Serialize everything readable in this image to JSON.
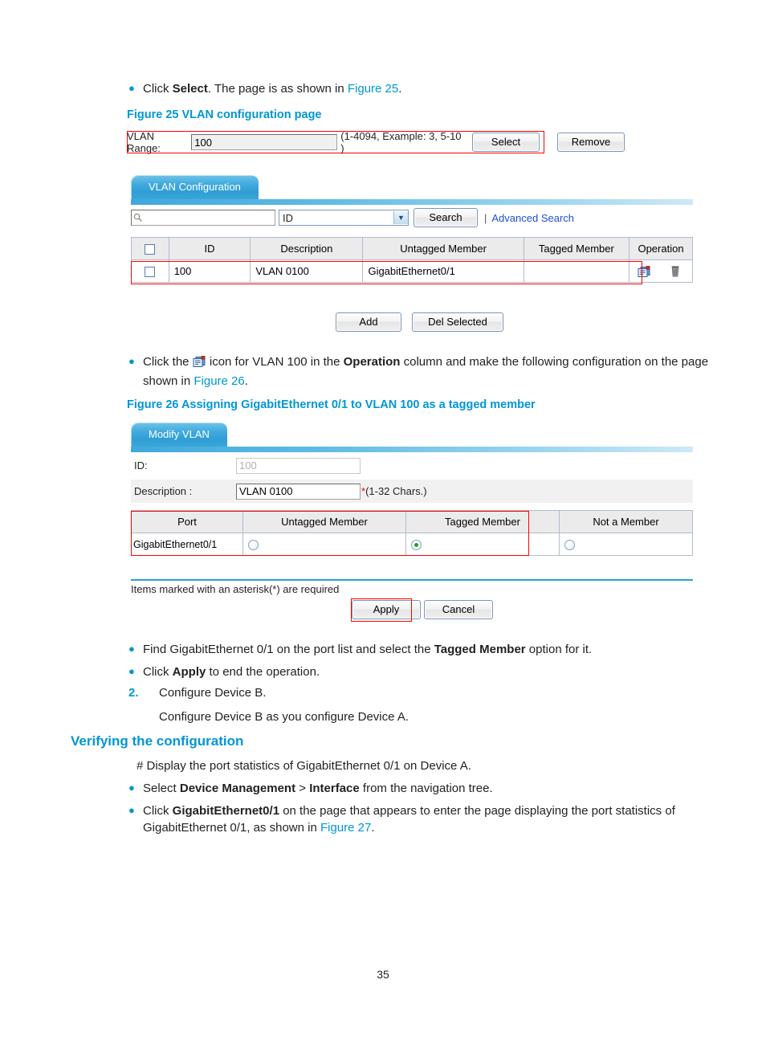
{
  "page_number": "35",
  "intro_bullet": {
    "text_before": "Click ",
    "bold": "Select",
    "text_mid": ". The page is as shown in ",
    "link": "Figure 25",
    "text_after": "."
  },
  "figure25": {
    "caption": "Figure 25 VLAN configuration page",
    "vlan_range": {
      "label": "VLAN Range:",
      "value": "100",
      "hint": "(1-4094, Example: 3, 5-10 )",
      "select_button": "Select",
      "remove_button": "Remove"
    },
    "tab_label": "VLAN Configuration",
    "search": {
      "input_value": "",
      "search_icon": "search-icon",
      "field_selector_value": "ID",
      "search_button": "Search",
      "separator": "|",
      "advanced_link": "Advanced Search"
    },
    "table": {
      "headers": [
        "",
        "ID",
        "Description",
        "Untagged Member",
        "Tagged Member",
        "Operation"
      ],
      "rows": [
        {
          "checked": false,
          "id": "100",
          "description": "VLAN 0100",
          "untagged_member": "GigabitEthernet0/1",
          "tagged_member": "",
          "operation_icons": [
            "edit-vlan-icon",
            "delete-vlan-icon"
          ]
        }
      ]
    },
    "buttons": {
      "add": "Add",
      "del_selected": "Del Selected"
    }
  },
  "icon_bullet": {
    "text_before": "Click the ",
    "icon": "edit-vlan-icon",
    "text_mid1": " icon for VLAN 100 in the ",
    "bold": "Operation",
    "text_mid2": " column and make the following configuration on the page shown in ",
    "link": "Figure 26",
    "text_after": "."
  },
  "figure26": {
    "caption": "Figure 26 Assigning GigabitEthernet 0/1 to VLAN 100 as a tagged member",
    "tab_label": "Modify VLAN",
    "fields": [
      {
        "label": "ID:",
        "value": "100",
        "disabled": true,
        "note": ""
      },
      {
        "label": "Description :",
        "value": "VLAN 0100",
        "disabled": false,
        "note_star": "*",
        "note": "(1-32 Chars.)"
      }
    ],
    "port_table": {
      "headers": [
        "Port",
        "Untagged Member",
        "Tagged Member",
        "Not a Member"
      ],
      "rows": [
        {
          "port": "GigabitEthernet0/1",
          "untagged_selected": false,
          "tagged_selected": true,
          "not_member_selected": false
        }
      ]
    },
    "required_note": "Items marked with an asterisk(*) are required",
    "buttons": {
      "apply": "Apply",
      "cancel": "Cancel"
    }
  },
  "steps": [
    {
      "marker": "bullet",
      "text_before": "Find GigabitEthernet 0/1 on the port list and select the ",
      "bold": "Tagged Member",
      "text_after": " option for it."
    },
    {
      "marker": "bullet",
      "text_before": "Click ",
      "bold": "Apply",
      "text_after": " to end the operation."
    },
    {
      "marker": "2.",
      "text_before": "Configure Device B.",
      "bold": "",
      "text_after": ""
    }
  ],
  "sub_paragraph": "Configure Device B as you configure Device A.",
  "verify": {
    "heading": "Verifying the configuration",
    "display_line": "# Display the port statistics of GigabitEthernet 0/1 on Device A.",
    "bullets": [
      {
        "text_before": "Select ",
        "bold1": "Device Management",
        "text_mid": " > ",
        "bold2": "Interface",
        "text_after": " from the navigation tree."
      },
      {
        "text_before": "Click ",
        "bold1": "GigabitEthernet0/1",
        "text_mid": " on the page that appears to enter the page displaying the port statistics of GigabitEthernet 0/1, as shown in ",
        "link": "Figure 27",
        "text_after": "."
      }
    ]
  },
  "colors": {
    "accent_blue": "#0096d6",
    "highlight_red": "#ff0000",
    "tab_blue": "#2f9ed4",
    "header_gray": "#ebebeb"
  }
}
